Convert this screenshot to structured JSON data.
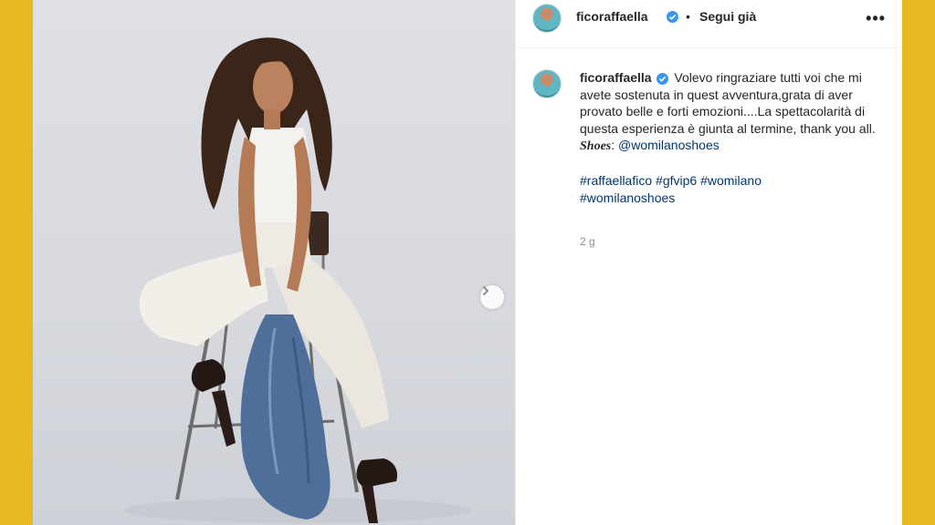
{
  "post": {
    "username": "ficoraffaella",
    "separator": "•",
    "follow_label": "Segui già",
    "more_icon": "•••"
  },
  "caption": {
    "username": "ficoraffaella",
    "text": "Volevo ringraziare tutti voi che mi avete sostenuta in quest avventura,grata di aver provato belle e forti emozioni....La spettacolarità di questa esperienza è giunta al termine, thank you all.",
    "shoes_label": "Shoes",
    "shoes_sep": ":",
    "shoes_mention": "@womilanoshoes",
    "hashtags": [
      "#raffaellafico",
      "#gfvip6",
      "#womilano",
      "#womilanoshoes"
    ],
    "age": "2 g"
  },
  "colors": {
    "frame": "#e6b922",
    "verified": "#3897f0",
    "link": "#00376b"
  }
}
